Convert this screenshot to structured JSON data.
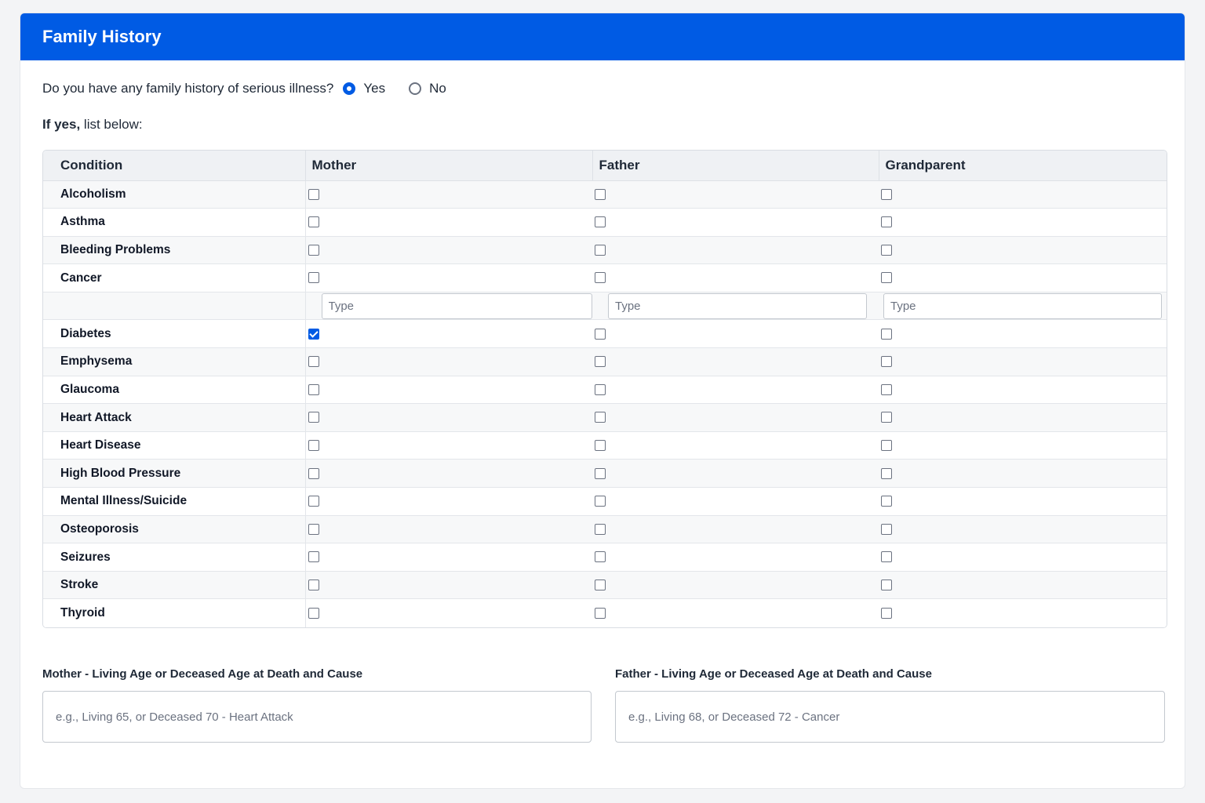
{
  "header": {
    "title": "Family History"
  },
  "question": {
    "text": "Do you have any family history of serious illness?",
    "yes_label": "Yes",
    "no_label": "No",
    "selected": "Yes"
  },
  "if_yes": {
    "bold": "If yes,",
    "rest": " list below:"
  },
  "table": {
    "columns": [
      "Condition",
      "Mother",
      "Father",
      "Grandparent"
    ],
    "conditions": [
      {
        "name": "Alcoholism",
        "mother": false,
        "father": false,
        "grandparent": false
      },
      {
        "name": "Asthma",
        "mother": false,
        "father": false,
        "grandparent": false
      },
      {
        "name": "Bleeding Problems",
        "mother": false,
        "father": false,
        "grandparent": false
      },
      {
        "name": "Cancer",
        "mother": false,
        "father": false,
        "grandparent": false
      },
      {
        "name": "Diabetes",
        "mother": true,
        "father": false,
        "grandparent": false
      },
      {
        "name": "Emphysema",
        "mother": false,
        "father": false,
        "grandparent": false
      },
      {
        "name": "Glaucoma",
        "mother": false,
        "father": false,
        "grandparent": false
      },
      {
        "name": "Heart Attack",
        "mother": false,
        "father": false,
        "grandparent": false
      },
      {
        "name": "Heart Disease",
        "mother": false,
        "father": false,
        "grandparent": false
      },
      {
        "name": "High Blood Pressure",
        "mother": false,
        "father": false,
        "grandparent": false
      },
      {
        "name": "Mental Illness/Suicide",
        "mother": false,
        "father": false,
        "grandparent": false
      },
      {
        "name": "Osteoporosis",
        "mother": false,
        "father": false,
        "grandparent": false
      },
      {
        "name": "Seizures",
        "mother": false,
        "father": false,
        "grandparent": false
      },
      {
        "name": "Stroke",
        "mother": false,
        "father": false,
        "grandparent": false
      },
      {
        "name": "Thyroid",
        "mother": false,
        "father": false,
        "grandparent": false
      }
    ],
    "cancer_type_placeholder": "Type"
  },
  "mother_age": {
    "label": "Mother - Living Age or Deceased Age at Death and Cause",
    "placeholder": "e.g., Living 65, or Deceased 70 - Heart Attack"
  },
  "father_age": {
    "label": "Father - Living Age or Deceased Age at Death and Cause",
    "placeholder": "e.g., Living 68, or Deceased 72 - Cancer"
  },
  "colors": {
    "accent": "#005be4"
  }
}
